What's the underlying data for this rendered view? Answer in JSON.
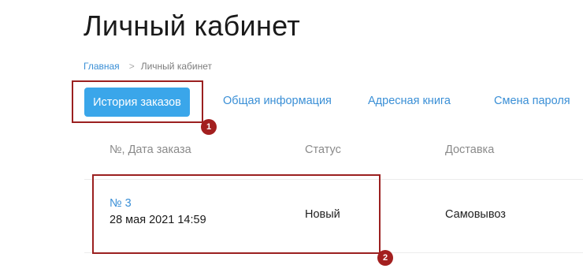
{
  "page": {
    "title": "Личный кабинет"
  },
  "breadcrumb": {
    "home": "Главная",
    "separator": ">",
    "current": "Личный кабинет"
  },
  "tabs": [
    {
      "label": "История заказов",
      "active": true
    },
    {
      "label": "Общая информация",
      "active": false
    },
    {
      "label": "Адресная книга",
      "active": false
    },
    {
      "label": "Смена пароля",
      "active": false
    }
  ],
  "orders_table": {
    "columns": [
      "№, Дата заказа",
      "Статус",
      "Доставка"
    ],
    "rows": [
      {
        "number": "№ 3",
        "date": "28 мая 2021 14:59",
        "status": "Новый",
        "delivery": "Самовывоз"
      }
    ]
  },
  "annotations": [
    {
      "label": "1"
    },
    {
      "label": "2"
    }
  ],
  "colors": {
    "accent": "#3aa6ea",
    "link": "#3a8fd6",
    "annotation": "#a31f1f"
  }
}
